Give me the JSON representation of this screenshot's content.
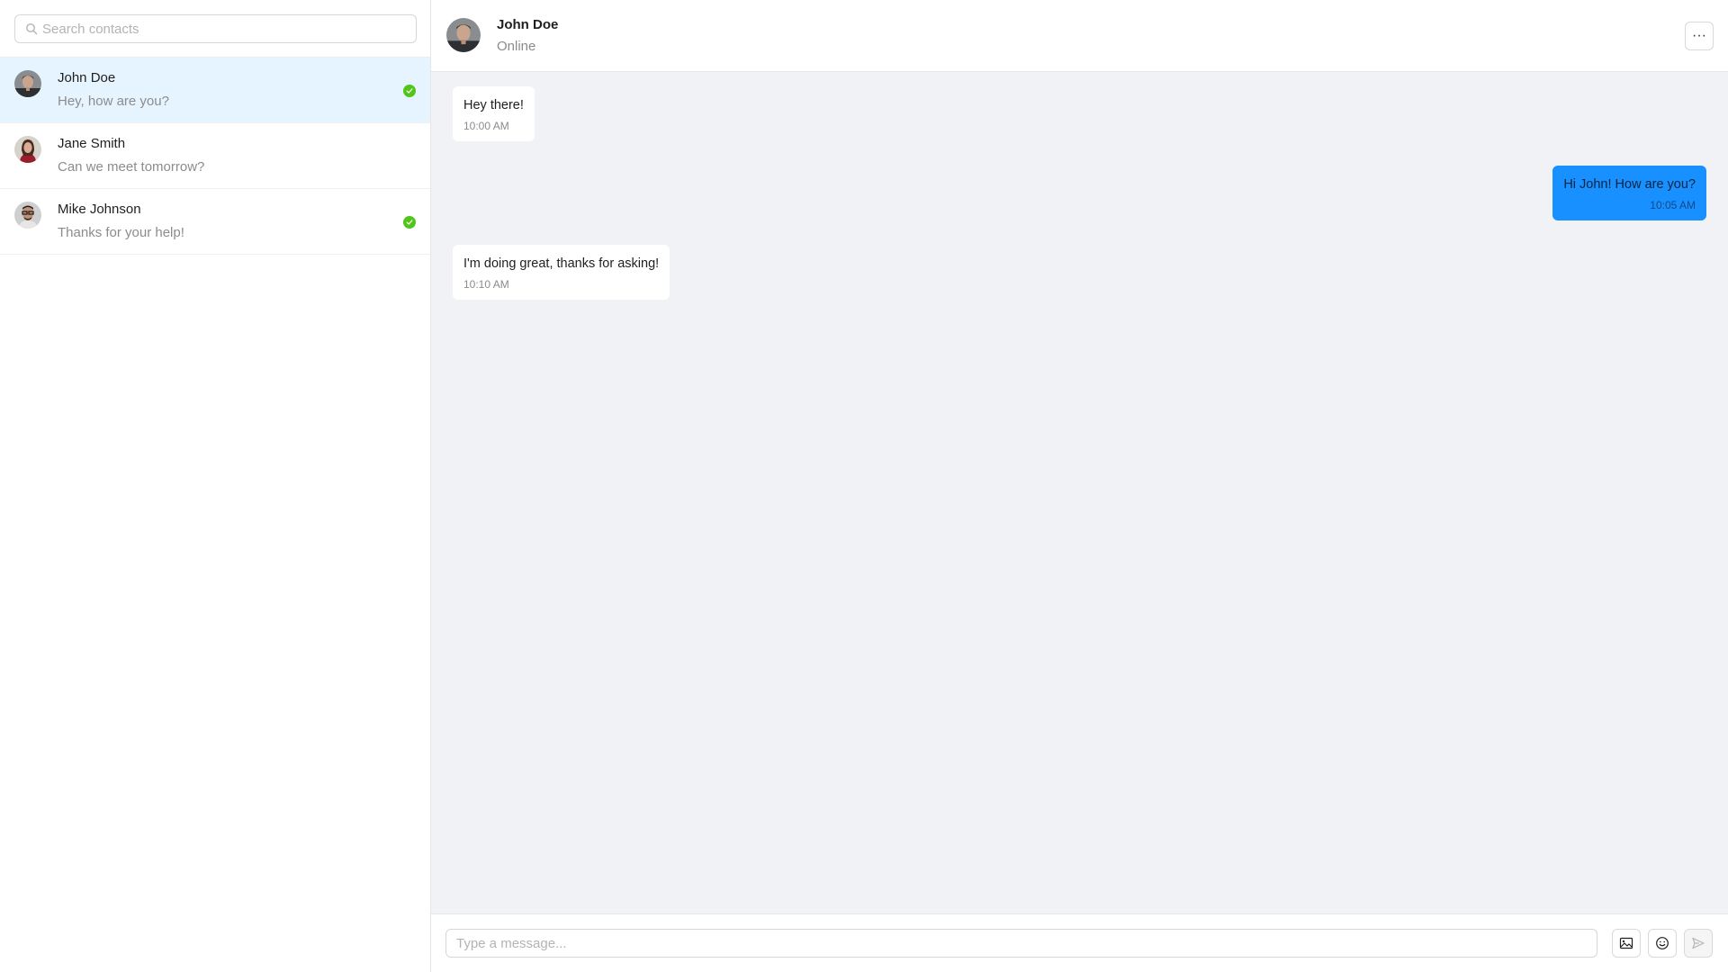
{
  "search": {
    "placeholder": "Search contacts"
  },
  "contacts": [
    {
      "name": "John Doe",
      "preview": "Hey, how are you?",
      "online": true,
      "active": true
    },
    {
      "name": "Jane Smith",
      "preview": "Can we meet tomorrow?",
      "online": false,
      "active": false
    },
    {
      "name": "Mike Johnson",
      "preview": "Thanks for your help!",
      "online": true,
      "active": false
    }
  ],
  "header": {
    "name": "John Doe",
    "status": "Online",
    "more_label": "···"
  },
  "messages": [
    {
      "text": "Hey there!",
      "time": "10:00 AM",
      "direction": "in"
    },
    {
      "text": "Hi John! How are you?",
      "time": "10:05 AM",
      "direction": "out"
    },
    {
      "text": "I'm doing great, thanks for asking!",
      "time": "10:10 AM",
      "direction": "in"
    }
  ],
  "composer": {
    "placeholder": "Type a message..."
  },
  "colors": {
    "accent": "#1890ff",
    "online": "#52c41a",
    "active_row": "#e6f4ff",
    "chat_bg": "#f0f2f5"
  },
  "icons": {
    "search": "search-icon",
    "check": "check-icon",
    "more": "more-icon",
    "image": "image-icon",
    "emoji": "smile-icon",
    "send": "send-icon"
  }
}
